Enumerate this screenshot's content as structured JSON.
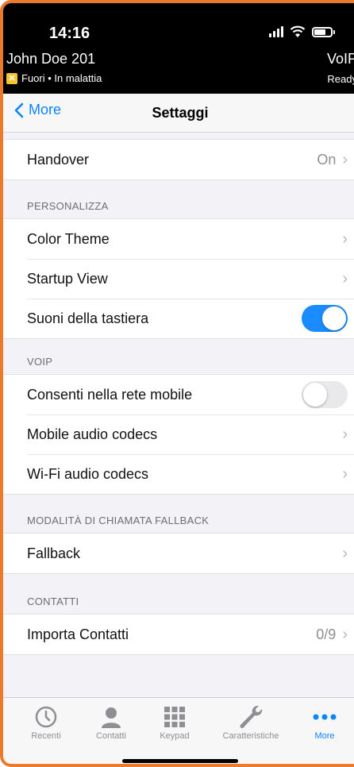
{
  "status_bar": {
    "time": "14:16"
  },
  "header": {
    "user_name": "John Doe 201",
    "status_text": "Fuori • In malattia",
    "status_badge": "✕",
    "right_title": "VoIP",
    "right_status": "Ready"
  },
  "nav": {
    "back_label": "More",
    "title": "Settaggi"
  },
  "rows": {
    "handover": {
      "label": "Handover",
      "value": "On"
    },
    "color_theme": {
      "label": "Color Theme"
    },
    "startup_view": {
      "label": "Startup View"
    },
    "keyboard_sounds": {
      "label": "Suoni della tastiera",
      "enabled": true
    },
    "mobile_network": {
      "label": "Consenti nella rete mobile",
      "enabled": false
    },
    "mobile_codecs": {
      "label": "Mobile audio codecs"
    },
    "wifi_codecs": {
      "label": "Wi-Fi audio codecs"
    },
    "fallback": {
      "label": "Fallback"
    },
    "import_contacts": {
      "label": "Importa Contatti",
      "value": "0/9"
    }
  },
  "sections": {
    "personalize": "PERSONALIZZA",
    "voip": "VOIP",
    "fallback_mode": "MODALITÀ DI CHIAMATA FALLBACK",
    "contacts": "CONTATTI"
  },
  "tabs": [
    {
      "label": "Recenti",
      "icon": "clock-icon"
    },
    {
      "label": "Contatti",
      "icon": "person-icon"
    },
    {
      "label": "Keypad",
      "icon": "keypad-icon"
    },
    {
      "label": "Caratteristiche",
      "icon": "wrench-icon"
    },
    {
      "label": "More",
      "icon": "more-dots-icon",
      "active": true
    }
  ],
  "colors": {
    "accent": "#0a84ff",
    "toggle_on": "#1a8cff",
    "frame": "#ec7a2d",
    "badge": "#f4c431"
  }
}
